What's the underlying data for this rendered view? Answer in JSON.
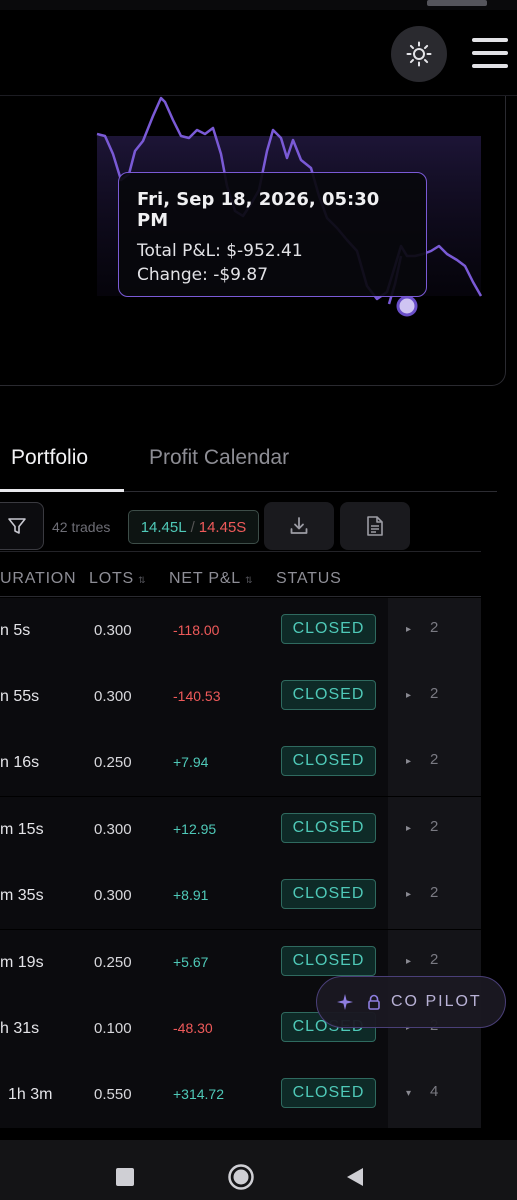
{
  "header": {
    "theme_icon": "sun-icon",
    "menu_icon": "hamburger-menu-icon"
  },
  "chart": {
    "line_color": "#7a5ad6",
    "tooltip": {
      "title": "Fri, Sep 18, 2026, 05:30 PM",
      "total_pnl": "Total P&L: $-952.41",
      "change": "Change: -$9.87"
    }
  },
  "tabs": [
    {
      "label": "Portfolio",
      "active": true
    },
    {
      "label": "Profit Calendar",
      "active": false
    }
  ],
  "toolbar": {
    "trades_count": "42 trades",
    "long_value": "14.45L",
    "separator": "/",
    "short_value": "14.45S"
  },
  "table": {
    "columns": [
      "URATION",
      "LOTS",
      "NET P&L",
      "STATUS"
    ],
    "rows": [
      {
        "duration": "n 5s",
        "lots": "0.300",
        "net_pnl": "-118.00",
        "status": "CLOSED",
        "expand": "▸",
        "count": "2"
      },
      {
        "duration": "n 55s",
        "lots": "0.300",
        "net_pnl": "-140.53",
        "status": "CLOSED",
        "expand": "▸",
        "count": "2"
      },
      {
        "duration": "n 16s",
        "lots": "0.250",
        "net_pnl": "+7.94",
        "status": "CLOSED",
        "expand": "▸",
        "count": "2"
      },
      {
        "duration": "m 15s",
        "lots": "0.300",
        "net_pnl": "+12.95",
        "status": "CLOSED",
        "expand": "▸",
        "count": "2"
      },
      {
        "duration": "m 35s",
        "lots": "0.300",
        "net_pnl": "+8.91",
        "status": "CLOSED",
        "expand": "▸",
        "count": "2"
      },
      {
        "duration": "m 19s",
        "lots": "0.250",
        "net_pnl": "+5.67",
        "status": "CLOSED",
        "expand": "▸",
        "count": "2"
      },
      {
        "duration": "h 31s",
        "lots": "0.100",
        "net_pnl": "-48.30",
        "status": "CLOSED",
        "expand": "▸",
        "count": "2"
      },
      {
        "duration": "1h 3m",
        "lots": "0.550",
        "net_pnl": "+314.72",
        "status": "CLOSED",
        "expand": "▾",
        "count": "4"
      }
    ]
  },
  "copilot": {
    "label": "CO PILOT"
  },
  "colors": {
    "accent": "#7a5ad6",
    "positive": "#4fc9b8",
    "negative": "#ef5a5a"
  }
}
